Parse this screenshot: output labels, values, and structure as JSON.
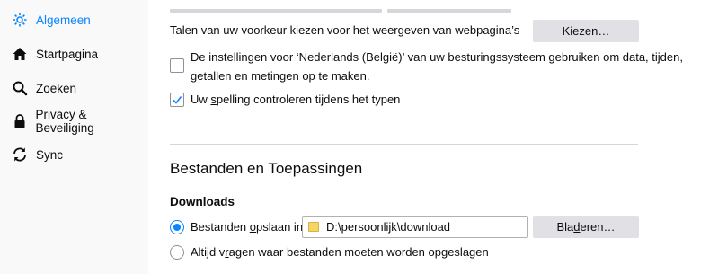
{
  "sidebar": {
    "items": [
      {
        "label": "Algemeen",
        "icon": "gear-icon",
        "active": true
      },
      {
        "label": "Startpagina",
        "icon": "home-icon",
        "active": false
      },
      {
        "label": "Zoeken",
        "icon": "search-icon",
        "active": false
      },
      {
        "label": "Privacy & Beveiliging",
        "icon": "lock-icon",
        "active": false
      },
      {
        "label": "Sync",
        "icon": "sync-icon",
        "active": false
      }
    ]
  },
  "language": {
    "label": "Talen van uw voorkeur kiezen voor het weergeven van webpagina’s",
    "choose_button": "Kiezen…"
  },
  "locale_checkbox": {
    "label_line1": "De instellingen voor ‘Nederlands (België)’ van uw besturingssysteem gebruiken om data, tijden,",
    "label_line2": "getallen en metingen op te maken.",
    "checked": false
  },
  "spelling_checkbox": {
    "label_pre": "Uw ",
    "label_u": "s",
    "label_post": "pelling controleren tijdens het typen",
    "checked": true
  },
  "files_section": {
    "title": "Bestanden en Toepassingen",
    "downloads_heading": "Downloads",
    "save_radio": {
      "label_pre": "Bestanden ",
      "label_u": "o",
      "label_post": "psla​an in",
      "checked": true
    },
    "path_value": "D:\\persoonlijk\\download",
    "browse_button_pre": "Bla",
    "browse_button_u": "d",
    "browse_button_post": "eren…",
    "ask_radio": {
      "label_pre": "Altijd v",
      "label_u": "r",
      "label_post": "agen waar bestanden moeten worden opgeslagen",
      "checked": false
    }
  },
  "colors": {
    "accent": "#0a84ff",
    "sidebar_bg": "#f9f9fa",
    "button_bg": "#e1e1e5"
  }
}
